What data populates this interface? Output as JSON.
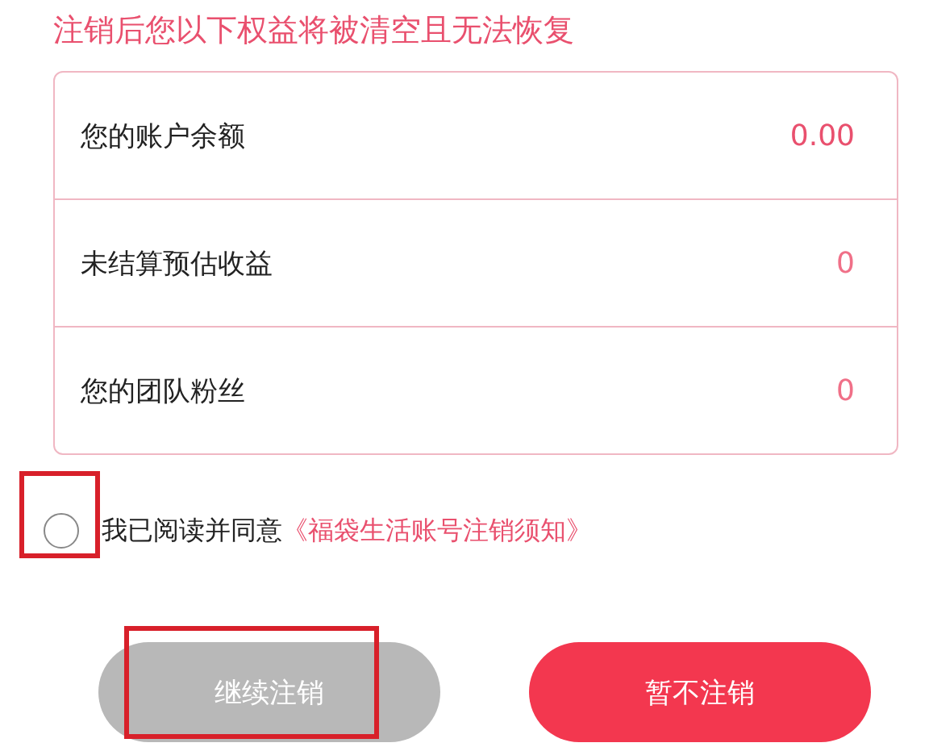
{
  "heading": "注销后您以下权益将被清空且无法恢复",
  "benefits": [
    {
      "label": "您的账户余额",
      "value": "0.00",
      "emphasis": true
    },
    {
      "label": "未结算预估收益",
      "value": "0",
      "emphasis": false
    },
    {
      "label": "您的团队粉丝",
      "value": "0",
      "emphasis": false
    }
  ],
  "agreement": {
    "checked": false,
    "highlighted": true,
    "text": "我已阅读并同意",
    "link": "《福袋生活账号注销须知》"
  },
  "buttons": [
    {
      "label": "继续注销",
      "kind": "secondary",
      "disabled": true,
      "highlighted": true
    },
    {
      "label": "暂不注销",
      "kind": "primary",
      "disabled": false,
      "highlighted": false
    }
  ]
}
